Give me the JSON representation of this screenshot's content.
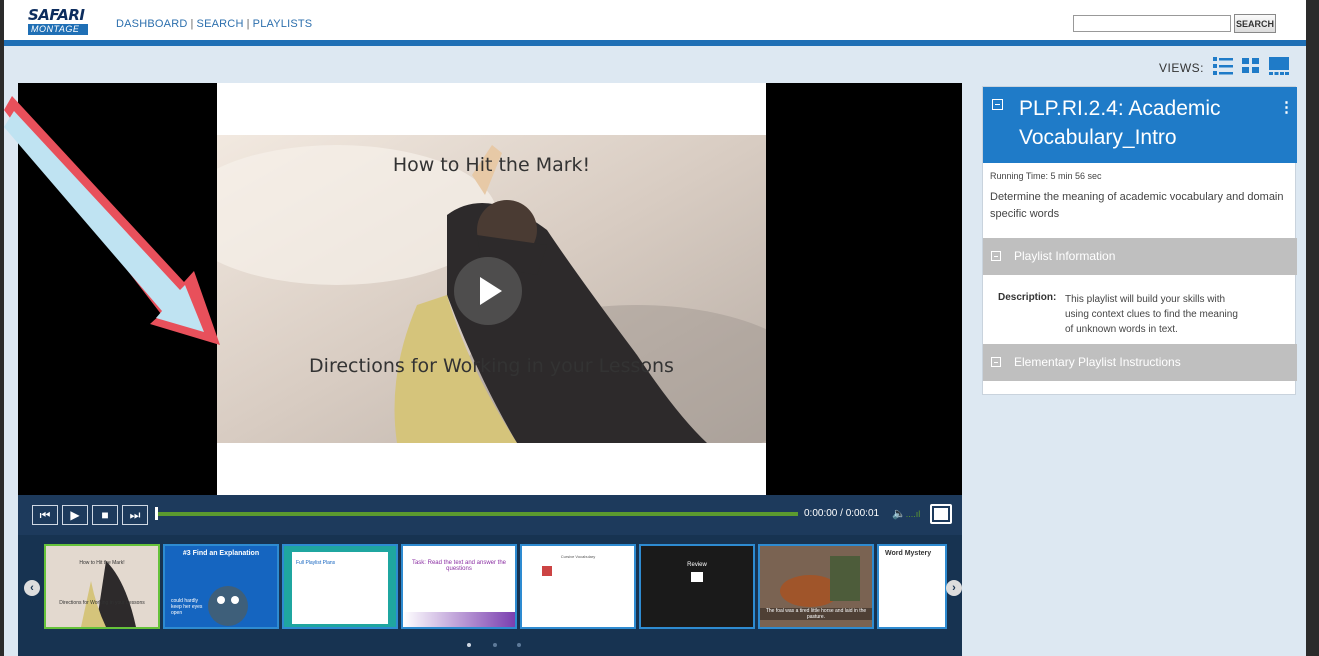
{
  "header": {
    "logo_top": "SAFARI",
    "logo_bottom": "MONTAGE",
    "nav": [
      "DASHBOARD",
      "SEARCH",
      "PLAYLISTS"
    ],
    "search_placeholder": "",
    "search_button": "SEARCH"
  },
  "views": {
    "label": "VIEWS:",
    "icons": [
      "list-view-icon",
      "grid-view-icon",
      "theater-view-icon"
    ]
  },
  "video": {
    "title_text": "How to Hit the Mark!",
    "subtitle_text": "Directions for Working in your Lessons",
    "time": "0:00:00 / 0:00:01",
    "progress": 0.0
  },
  "thumbnails": [
    {
      "label": "How to Hit the Mark!",
      "sub": "Directions for Working in your Lessons"
    },
    {
      "label": "#3 Find an Explanation",
      "sub": "could hardly keep her eyes open"
    },
    {
      "label": "Full Playlist Plans",
      "sub": ""
    },
    {
      "label": "Task: Read the text and answer the questions",
      "sub": ""
    },
    {
      "label": "Cursive Vocabulary",
      "sub": ""
    },
    {
      "label": "Review",
      "sub": ""
    },
    {
      "label": "The foal was a tired little horse and laid in the pasture.",
      "sub": ""
    },
    {
      "label": "Word Mystery",
      "sub": ""
    }
  ],
  "panel": {
    "title": "PLP.RI.2.4: Academic Vocabulary_Intro",
    "running_time": "Running Time: 5 min 56 sec",
    "description": "Determine the meaning of academic vocabulary and domain specific words",
    "sections": [
      {
        "title": "Playlist Information"
      },
      {
        "title": "Elementary Playlist Instructions"
      }
    ],
    "playlist_desc_label": "Description:",
    "playlist_desc_lines": [
      "This playlist will build your skills with",
      "using context clues to find the meaning",
      "of unknown words in text."
    ]
  },
  "colors": {
    "accent": "#1f7bc8",
    "header_line": "#1f6fb5",
    "player_bg": "#1d3a5c",
    "progress": "#5b9a2f",
    "annotation_arrow": "#e8505b"
  }
}
